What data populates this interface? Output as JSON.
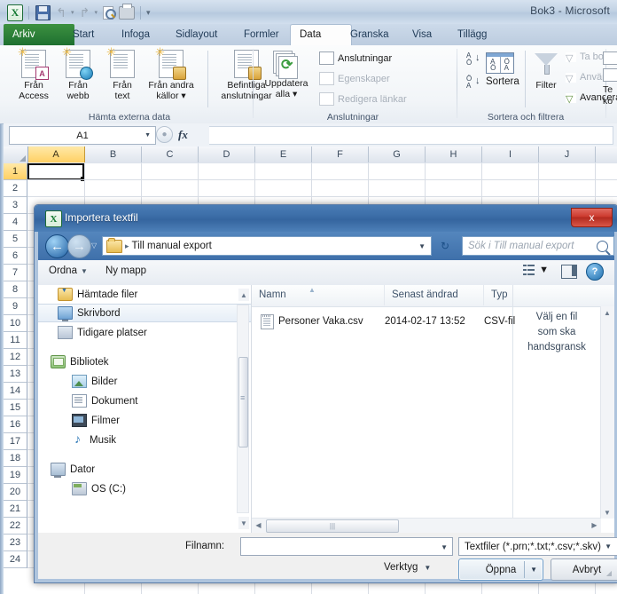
{
  "excel": {
    "title": "Bok3  -  Microsoft",
    "quick_access": [
      {
        "name": "excel-logo-icon",
        "label": "X"
      },
      {
        "name": "save-icon",
        "label": "Spara"
      },
      {
        "name": "undo-icon",
        "label": "Ångra"
      },
      {
        "name": "redo-icon",
        "label": "Gör om"
      },
      {
        "name": "print-preview-icon",
        "label": "Förhandsgranska"
      },
      {
        "name": "quick-print-icon",
        "label": "Snabbutskrift"
      },
      {
        "name": "customize-qat-icon",
        "label": "Anpassa verktygsfältet Snabbåtkomst"
      }
    ],
    "tabs": [
      {
        "label": "Arkiv",
        "state": "file"
      },
      {
        "label": "Start",
        "state": "normal"
      },
      {
        "label": "Infoga",
        "state": "normal"
      },
      {
        "label": "Sidlayout",
        "state": "normal"
      },
      {
        "label": "Formler",
        "state": "normal"
      },
      {
        "label": "Data",
        "state": "active"
      },
      {
        "label": "Granska",
        "state": "normal"
      },
      {
        "label": "Visa",
        "state": "normal"
      },
      {
        "label": "Tillägg",
        "state": "normal"
      }
    ],
    "ribbon": {
      "groups": [
        {
          "label": "Hämta externa data"
        },
        {
          "label": "Anslutningar"
        },
        {
          "label": "Sortera och filtrera"
        },
        {
          "label": ""
        }
      ],
      "get_external": [
        {
          "line1": "Från",
          "line2": "Access"
        },
        {
          "line1": "Från",
          "line2": "webb"
        },
        {
          "line1": "Från",
          "line2": "text"
        },
        {
          "line1": "Från andra",
          "line2": "källor ▾"
        }
      ],
      "existing_connections": {
        "line1": "Befintliga",
        "line2": "anslutningar"
      },
      "refresh_all": {
        "line1": "Uppdatera",
        "line2": "alla ▾"
      },
      "connections_small": [
        {
          "label": "Anslutningar",
          "enabled": true
        },
        {
          "label": "Egenskaper",
          "enabled": false
        },
        {
          "label": "Redigera länkar",
          "enabled": false
        }
      ],
      "sort_label": "Sortera",
      "filter_label": "Filter",
      "filter_small": [
        {
          "label": "Ta bort",
          "enabled": false
        },
        {
          "label": "Använd igen",
          "enabled": false
        },
        {
          "label": "Avancerat",
          "enabled": true
        }
      ],
      "text_to_columns": {
        "line1": "Te",
        "line2": "ko"
      }
    },
    "formula_bar": {
      "name_box": "A1",
      "formula": ""
    },
    "grid": {
      "columns": [
        "A",
        "B",
        "C",
        "D",
        "E",
        "F",
        "G",
        "H",
        "I",
        "J"
      ],
      "selected_column": "A",
      "selected_cell": "A1",
      "rows": [
        1,
        2,
        3,
        4,
        5,
        6,
        7,
        8,
        9,
        10,
        11,
        12,
        13,
        14,
        15,
        16,
        17,
        18,
        19,
        20,
        21,
        22,
        23,
        24
      ]
    }
  },
  "dialog": {
    "title": "Importera textfil",
    "close_label": "x",
    "address": {
      "crumb": "Till manual export",
      "search_placeholder": "Sök i Till manual export"
    },
    "commandbar": {
      "organize": "Ordna",
      "new_folder": "Ny mapp",
      "help": "?"
    },
    "nav_items": [
      {
        "label": "Hämtade filer",
        "icon": "downloads-icon",
        "indent": 1,
        "selected": false
      },
      {
        "label": "Skrivbord",
        "icon": "desktop-icon",
        "indent": 1,
        "selected": true
      },
      {
        "label": "Tidigare platser",
        "icon": "recent-places-icon",
        "indent": 1,
        "selected": false
      },
      {
        "label": "Bibliotek",
        "icon": "libraries-icon",
        "indent": 0,
        "selected": false
      },
      {
        "label": "Bilder",
        "icon": "pictures-icon",
        "indent": 2,
        "selected": false
      },
      {
        "label": "Dokument",
        "icon": "documents-icon",
        "indent": 2,
        "selected": false
      },
      {
        "label": "Filmer",
        "icon": "videos-icon",
        "indent": 2,
        "selected": false
      },
      {
        "label": "Musik",
        "icon": "music-icon",
        "indent": 2,
        "selected": false
      },
      {
        "label": "Dator",
        "icon": "computer-icon",
        "indent": 0,
        "selected": false
      },
      {
        "label": "OS (C:)",
        "icon": "drive-icon",
        "indent": 2,
        "selected": false
      }
    ],
    "file_list": {
      "columns": [
        "Namn",
        "Senast ändrad",
        "Typ"
      ],
      "sorted_by": "Namn",
      "rows": [
        {
          "name": "Personer Vaka.csv",
          "modified": "2014-02-17 13:52",
          "type": "CSV-fil"
        }
      ]
    },
    "preview_pane": {
      "line1": "Välj en fil",
      "line2": "som ska",
      "line3": "handsgransk"
    },
    "footer": {
      "filename_label": "Filnamn:",
      "filename_value": "",
      "filetype_value": "Textfiler (*.prn;*.txt;*.csv;*.skv)",
      "tools_label": "Verktyg",
      "open_label": "Öppna",
      "cancel_label": "Avbryt"
    }
  }
}
